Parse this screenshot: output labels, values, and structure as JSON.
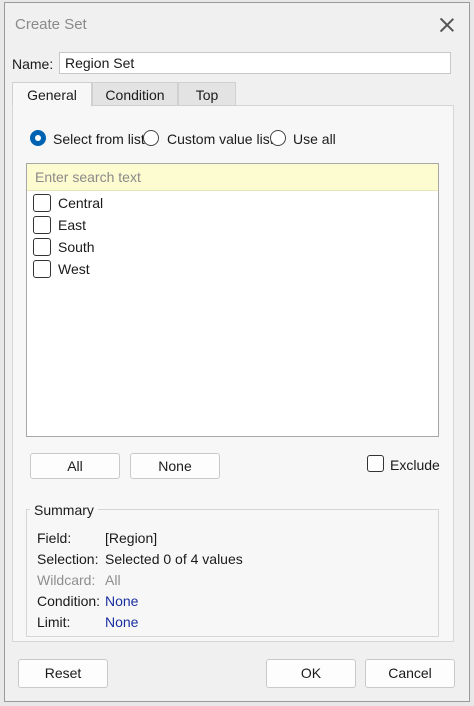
{
  "window": {
    "title": "Create Set"
  },
  "name": {
    "label": "Name:",
    "value": "Region Set"
  },
  "tabs": [
    {
      "label": "General",
      "active": true
    },
    {
      "label": "Condition",
      "active": false
    },
    {
      "label": "Top",
      "active": false
    }
  ],
  "mode": {
    "options": [
      {
        "label": "Select from list",
        "selected": true
      },
      {
        "label": "Custom value list",
        "selected": false
      },
      {
        "label": "Use all",
        "selected": false
      }
    ]
  },
  "search": {
    "placeholder": "Enter search text"
  },
  "items": [
    {
      "label": "Central",
      "checked": false
    },
    {
      "label": "East",
      "checked": false
    },
    {
      "label": "South",
      "checked": false
    },
    {
      "label": "West",
      "checked": false
    }
  ],
  "list_buttons": {
    "all": "All",
    "none": "None"
  },
  "exclude": {
    "label": "Exclude",
    "checked": false
  },
  "summary": {
    "title": "Summary",
    "rows": [
      {
        "key": "Field:",
        "value": "[Region]"
      },
      {
        "key": "Selection:",
        "value": "Selected 0 of 4 values"
      },
      {
        "key": "Wildcard:",
        "value": "All"
      },
      {
        "key": "Condition:",
        "value": "None"
      },
      {
        "key": "Limit:",
        "value": "None"
      }
    ]
  },
  "footer": {
    "reset": "Reset",
    "ok": "OK",
    "cancel": "Cancel"
  },
  "colors": {
    "accent": "#0063b1",
    "search_bg": "#fdfbd0",
    "link": "#1a2fa0"
  }
}
